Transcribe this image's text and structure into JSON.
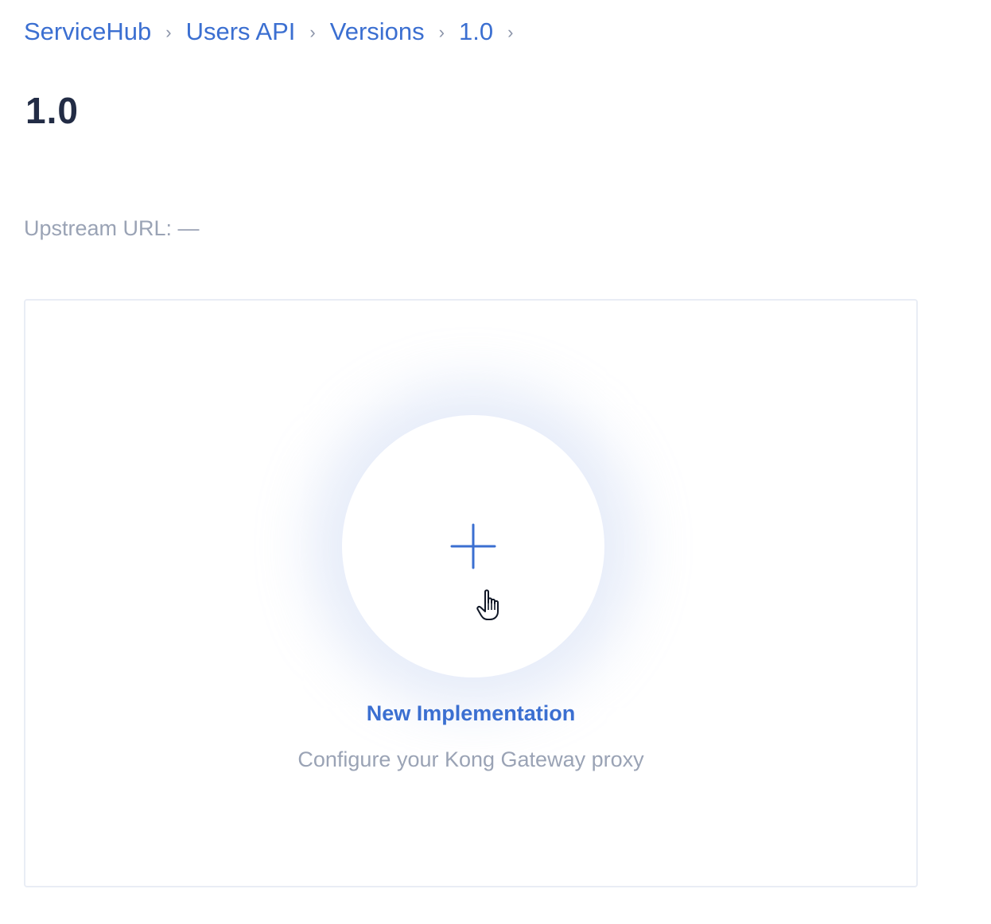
{
  "breadcrumb": {
    "items": [
      {
        "label": "ServiceHub"
      },
      {
        "label": "Users API"
      },
      {
        "label": "Versions"
      },
      {
        "label": "1.0"
      }
    ],
    "separator": "›"
  },
  "page": {
    "title": "1.0",
    "upstream_url_label": "Upstream URL: —"
  },
  "implementation_card": {
    "title": "New Implementation",
    "subtitle": "Configure your Kong Gateway proxy",
    "add_icon": "plus-icon",
    "cursor_icon": "hand-pointer-icon"
  },
  "colors": {
    "link": "#3b6fd1",
    "title": "#222c45",
    "muted": "#9aa3b5",
    "card_border": "#e9edf5"
  }
}
